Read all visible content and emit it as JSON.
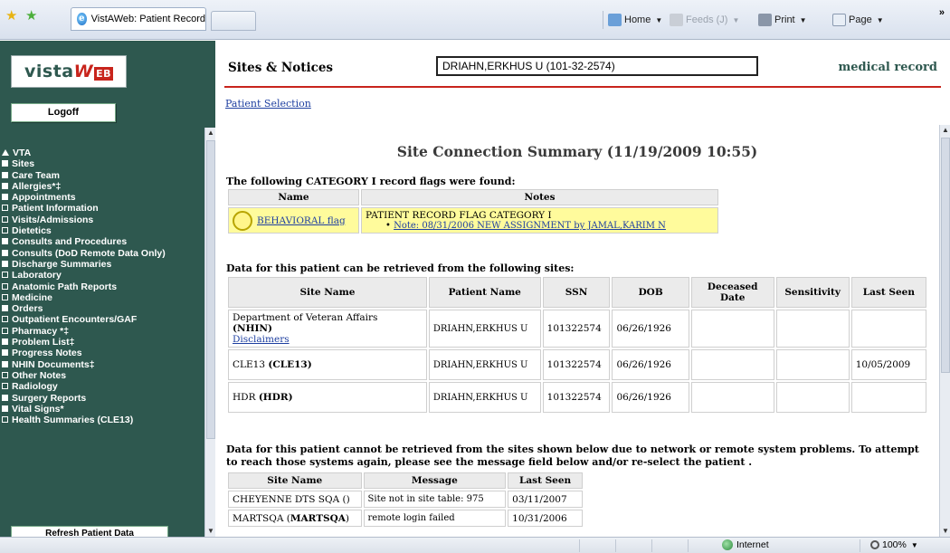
{
  "browser": {
    "tab_title": "VistAWeb: Patient Record",
    "home_label": "Home",
    "feeds_label": "Feeds (J)",
    "print_label": "Print",
    "page_label": "Page",
    "overflow": "»"
  },
  "sidebar": {
    "logo_text": "vista",
    "logo_w": "W",
    "logo_eb": "EB",
    "logoff_label": "Logoff",
    "refresh_label": "Refresh Patient Data",
    "items": [
      {
        "label": "VTA",
        "bullet": "tri"
      },
      {
        "label": "Sites",
        "bullet": "sq"
      },
      {
        "label": "Care Team",
        "bullet": "sq"
      },
      {
        "label": "Allergies*‡",
        "bullet": "sq"
      },
      {
        "label": "Appointments",
        "bullet": "sq"
      },
      {
        "label": "Patient Information",
        "bullet": "pl"
      },
      {
        "label": "Visits/Admissions",
        "bullet": "pl"
      },
      {
        "label": "Dietetics",
        "bullet": "pl"
      },
      {
        "label": "Consults and Procedures",
        "bullet": "sq"
      },
      {
        "label": "Consults (DoD Remote Data Only)",
        "bullet": "sq"
      },
      {
        "label": "Discharge Summaries",
        "bullet": "sq"
      },
      {
        "label": "Laboratory",
        "bullet": "pl"
      },
      {
        "label": "Anatomic Path Reports",
        "bullet": "pl"
      },
      {
        "label": "Medicine",
        "bullet": "pl"
      },
      {
        "label": "Orders",
        "bullet": "sq"
      },
      {
        "label": "Outpatient Encounters/GAF",
        "bullet": "pl"
      },
      {
        "label": "Pharmacy *‡",
        "bullet": "pl"
      },
      {
        "label": "Problem List‡",
        "bullet": "sq"
      },
      {
        "label": "Progress Notes",
        "bullet": "sq"
      },
      {
        "label": "NHIN Documents‡",
        "bullet": "sq"
      },
      {
        "label": "Other Notes",
        "bullet": "pl"
      },
      {
        "label": "Radiology",
        "bullet": "pl"
      },
      {
        "label": "Surgery Reports",
        "bullet": "sq"
      },
      {
        "label": "Vital Signs*",
        "bullet": "sq"
      },
      {
        "label": "Health Summaries (CLE13)",
        "bullet": "pl"
      }
    ]
  },
  "header": {
    "section_title": "Sites & Notices",
    "patient_field": "DRIAHN,ERKHUS U (101-32-2574)",
    "app_tagline": "medical record",
    "patient_selection_link": "Patient Selection"
  },
  "summary": {
    "title": "Site Connection Summary (11/19/2009 10:55)",
    "flags_heading": "The following CATEGORY I record flags were found:",
    "flags_columns": [
      "Name",
      "Notes"
    ],
    "flag": {
      "name": "BEHAVIORAL flag",
      "category": "PATIENT RECORD FLAG CATEGORY I",
      "note": "Note: 08/31/2006 NEW ASSIGNMENT by JAMAL,KARIM N"
    },
    "retrieved_heading": "Data for this patient can be retrieved from the following sites:",
    "sites_columns": [
      "Site Name",
      "Patient Name",
      "SSN",
      "DOB",
      "Deceased Date",
      "Sensitivity",
      "Last Seen"
    ],
    "sites": [
      {
        "site_prefix": "Department of Veteran Affairs",
        "site_code": "NHIN",
        "link": "Disclaimers",
        "patient": "DRIAHN,ERKHUS U",
        "ssn": "101322574",
        "dob": "06/26/1926",
        "deceased": "",
        "sensitivity": "",
        "last_seen": ""
      },
      {
        "site_prefix": "CLE13",
        "site_code": "CLE13",
        "link": "",
        "patient": "DRIAHN,ERKHUS U",
        "ssn": "101322574",
        "dob": "06/26/1926",
        "deceased": "",
        "sensitivity": "",
        "last_seen": "10/05/2009"
      },
      {
        "site_prefix": "HDR",
        "site_code": "HDR",
        "link": "",
        "patient": "DRIAHN,ERKHUS U",
        "ssn": "101322574",
        "dob": "06/26/1926",
        "deceased": "",
        "sensitivity": "",
        "last_seen": ""
      }
    ],
    "problem_heading": "Data for this patient cannot be retrieved from the sites shown below due to network or remote system problems. To attempt to reach those systems again, please see the message field below and/or re-select the patient .",
    "problem_columns": [
      "Site Name",
      "Message",
      "Last Seen"
    ],
    "problem_sites": [
      {
        "site": "CHEYENNE DTS SQA ()",
        "message": "Site not in site table: 975",
        "last_seen": "03/11/2007"
      },
      {
        "site_prefix": "MARTSQA",
        "site_code": "MARTSQA",
        "message": "remote login failed",
        "last_seen": "10/31/2006"
      }
    ]
  },
  "statusbar": {
    "zone": "Internet",
    "zoom": "100%"
  }
}
